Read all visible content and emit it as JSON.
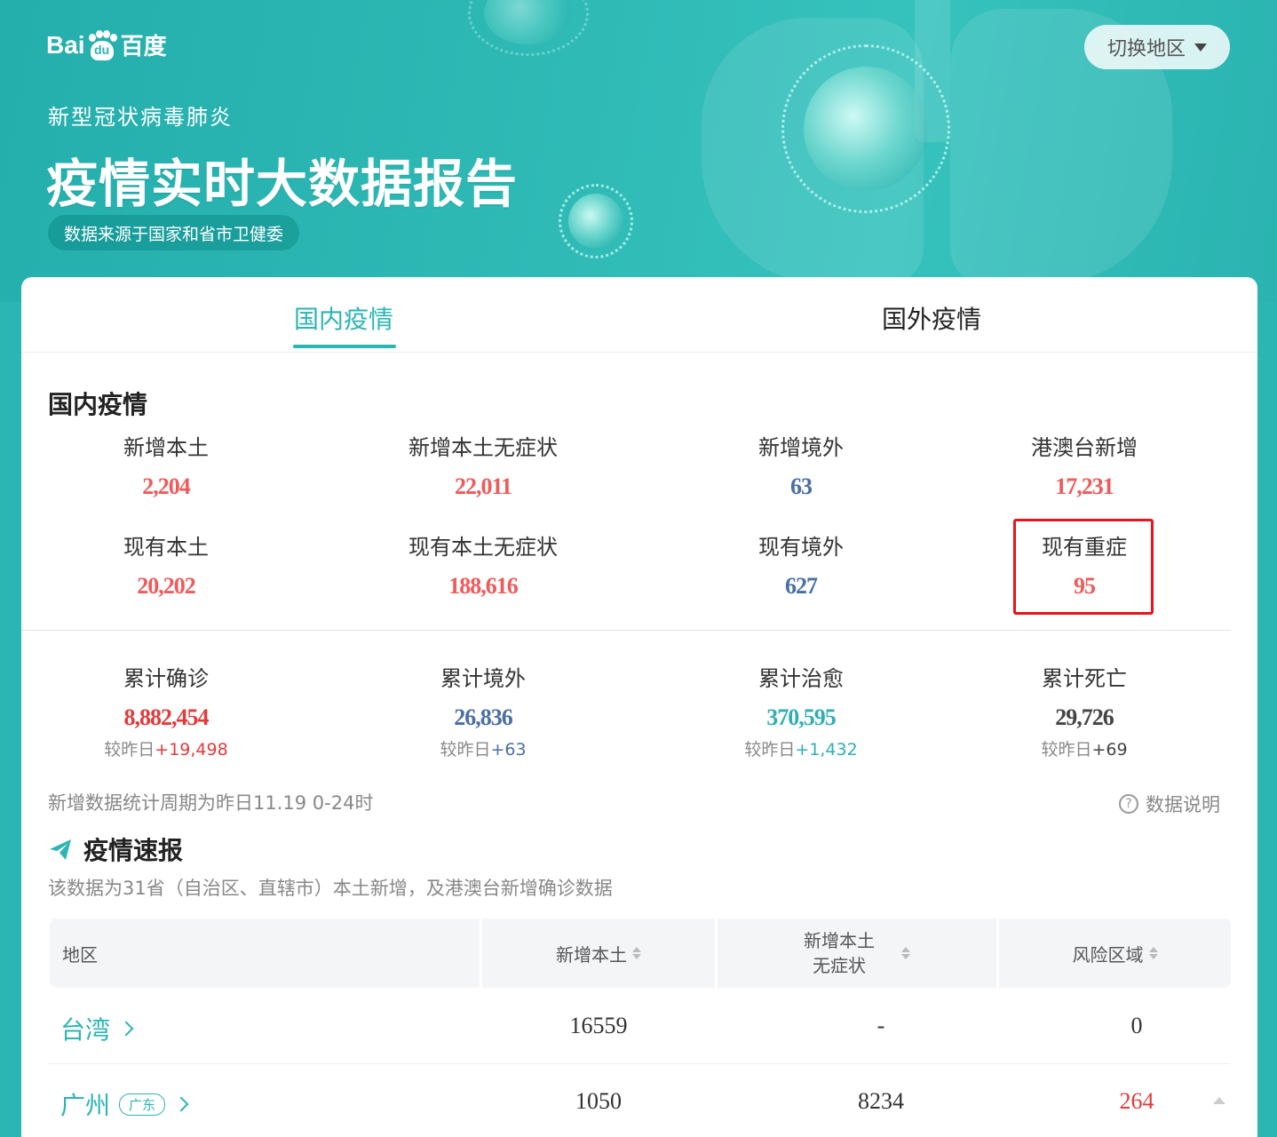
{
  "brand": {
    "logo_latin": "Bai",
    "logo_du": "du",
    "logo_cn": "百度"
  },
  "header": {
    "subtitle": "新型冠状病毒肺炎",
    "title": "疫情实时大数据报告",
    "source": "数据来源于国家和省市卫健委",
    "switch_region": "切换地区"
  },
  "tabs": [
    {
      "label": "国内疫情",
      "active": true
    },
    {
      "label": "国外疫情",
      "active": false
    }
  ],
  "section_title": "国内疫情",
  "stats_new": [
    {
      "label": "新增本土",
      "value": "2,204"
    },
    {
      "label": "新增本土无症状",
      "value": "22,011"
    },
    {
      "label": "新增境外",
      "value": "63"
    },
    {
      "label": "港澳台新增",
      "value": "17,231"
    }
  ],
  "stats_current": [
    {
      "label": "现有本土",
      "value": "20,202"
    },
    {
      "label": "现有本土无症状",
      "value": "188,616"
    },
    {
      "label": "现有境外",
      "value": "627"
    },
    {
      "label": "现有重症",
      "value": "95"
    }
  ],
  "stats_total": [
    {
      "label": "累计确诊",
      "value": "8,882,454",
      "delta_prefix": "较昨日",
      "delta": "+19,498"
    },
    {
      "label": "累计境外",
      "value": "26,836",
      "delta_prefix": "较昨日",
      "delta": "+63"
    },
    {
      "label": "累计治愈",
      "value": "370,595",
      "delta_prefix": "较昨日",
      "delta": "+1,432"
    },
    {
      "label": "累计死亡",
      "value": "29,726",
      "delta_prefix": "较昨日",
      "delta": "+69"
    }
  ],
  "period_note": "新增数据统计周期为昨日11.19 0-24时",
  "data_explain": "数据说明",
  "news": {
    "title": "疫情速报",
    "desc": "该数据为31省（自治区、直辖市）本土新增，及港澳台新增确诊数据"
  },
  "table": {
    "headers": {
      "area": "地区",
      "new_local": "新增本土",
      "new_asym_line1": "新增本土",
      "new_asym_line2": "无症状",
      "risk": "风险区域"
    },
    "rows": [
      {
        "region": "台湾",
        "tag": "",
        "new_local": "16559",
        "new_asym": "-",
        "risk": "0"
      },
      {
        "region": "广州",
        "tag": "广东",
        "new_local": "1050",
        "new_asym": "8234",
        "risk": "264"
      }
    ]
  },
  "colors": {
    "brand_teal": "#2bb5b3",
    "red": "#f05a5a",
    "blue": "#4a6fa5",
    "highlight": "#e8141c"
  }
}
